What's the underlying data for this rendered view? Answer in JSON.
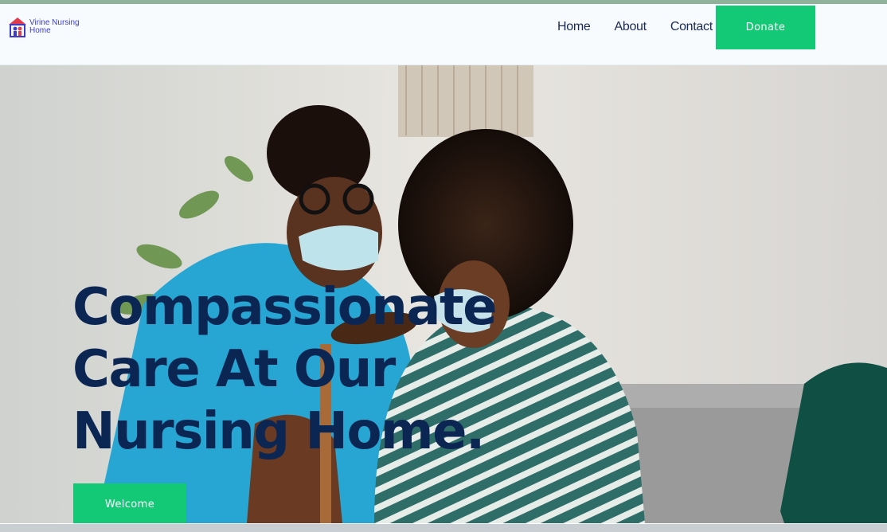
{
  "brand": {
    "name": "Virine Nursing Home",
    "colors": {
      "accent": "#14c975",
      "heading": "#0c2653",
      "nav_text": "#1b2a55",
      "logo_text": "#3c3cc8"
    }
  },
  "nav": {
    "items": [
      {
        "label": "Home"
      },
      {
        "label": "About"
      },
      {
        "label": "Contact"
      }
    ],
    "donate_label": "Donate"
  },
  "hero": {
    "title_lines": [
      "Compassionate",
      "Care At Our",
      "Nursing Home."
    ],
    "cta_label": "Welcome",
    "photo_icon": "caregiver-with-elderly-woman-photo"
  }
}
